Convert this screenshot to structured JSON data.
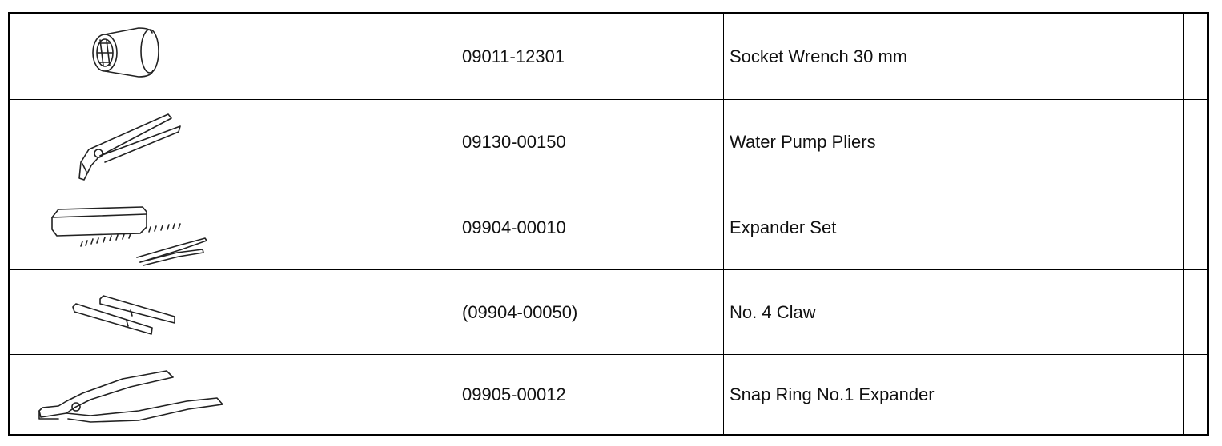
{
  "tools": [
    {
      "icon": "socket-wrench-icon",
      "part_number": "09011-12301",
      "name": "Socket Wrench 30 mm",
      "extra": ""
    },
    {
      "icon": "water-pump-pliers-icon",
      "part_number": "09130-00150",
      "name": "Water Pump Pliers",
      "extra": ""
    },
    {
      "icon": "expander-set-icon",
      "part_number": "09904-00010",
      "name": "Expander Set",
      "extra": ""
    },
    {
      "icon": "claw-icon",
      "part_number": "(09904-00050)",
      "name": "No. 4 Claw",
      "extra": ""
    },
    {
      "icon": "snap-ring-expander-icon",
      "part_number": "09905-00012",
      "name": "Snap Ring No.1 Expander",
      "extra": ""
    }
  ]
}
